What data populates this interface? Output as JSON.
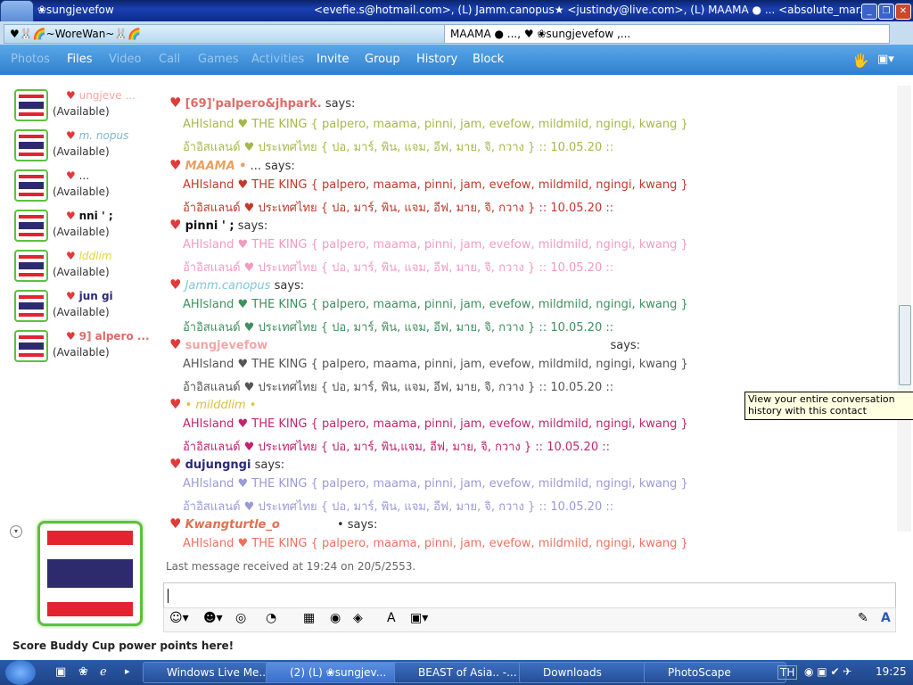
{
  "window": {
    "title": "❀sungjevefow",
    "title_participants": "<evefie.s@hotmail.com>, (L) Jamm.canopus★ <justindy@live.com>, (L) MAAMA ● ... <absolute_mar...",
    "controls": [
      "minimize",
      "restore",
      "close"
    ]
  },
  "conversation_tabs": [
    {
      "label": "♥🐰🌈~WoreWan~🐰🌈"
    },
    {
      "label": "MAAMA ● ..., ♥ ❀sungjevefow ,..."
    }
  ],
  "menu": {
    "items": [
      {
        "label": "Photos",
        "enabled": false
      },
      {
        "label": "Files",
        "enabled": true
      },
      {
        "label": "Video",
        "enabled": false
      },
      {
        "label": "Call",
        "enabled": false
      },
      {
        "label": "Games",
        "enabled": false
      },
      {
        "label": "Activities",
        "enabled": false
      },
      {
        "label": "Invite",
        "enabled": true
      },
      {
        "label": "Group",
        "enabled": true
      },
      {
        "label": "History",
        "enabled": true
      },
      {
        "label": "Block",
        "enabled": true
      }
    ]
  },
  "contacts": [
    {
      "name": "ungjeve ...",
      "name_color": "#f4a6a6",
      "status": "(Available)"
    },
    {
      "name": "m. nopus",
      "name_color": "#7fb6d9",
      "status": "(Available)"
    },
    {
      "name": "...",
      "name_color": "#333333",
      "status": "(Available)"
    },
    {
      "name": "nni ' ;",
      "name_color": "#111111",
      "status": "(Available)"
    },
    {
      "name": "lddlim",
      "name_color": "#e6d23a",
      "status": "(Available)"
    },
    {
      "name": "jun gi",
      "name_color": "#2a2a7a",
      "status": "(Available)"
    },
    {
      "name": "9] alpero ...",
      "name_color": "#e06a6a",
      "status": "(Available)"
    }
  ],
  "messages": [
    {
      "sender": "[69]'palpero&jhpark.",
      "sender_color": "#e06a6a",
      "says": "says:",
      "line1": "AHIsland ♥ THE KING { palpero, maama, pinni, jam, evefow, mildmild, ngingi, kwang }",
      "line2": "อ้าอิสแลนด์ ♥ ประเทศไทย { ปอ, มาร์, พิน, แจม, อีฟ, มาย, จิ, กวาง } :: 10.05.20 ::",
      "color": "#a6b84a"
    },
    {
      "sender": "MAAMA •",
      "sender_color": "#e8a060",
      "says": "... says:",
      "line1": "AHIsland ♥ THE KING { palpero, maama, pinni, jam, evefow, mildmild, ngingi, kwang }",
      "line2": "อ้าอิสแลนด์ ♥ ประเทศไทย { ปอ, มาร์, พิน, แจม, อีฟ, มาย, จิ, กวาง } :: 10.05.20 ::",
      "color": "#c0392b"
    },
    {
      "sender": "pinni ' ;",
      "sender_color": "#111111",
      "says": "says:",
      "line1": "AHIsland ♥ THE KING { palpero, maama, pinni, jam, evefow, mildmild, ngingi, kwang }",
      "line2": "อ้าอิสแลนด์ ♥ ประเทศไทย { ปอ, มาร์, พิน, แจม, อีฟ, มาย, จิ, กวาง } :: 10.05.20 ::",
      "color": "#f29ac0"
    },
    {
      "sender": "Jamm.canopus",
      "sender_color": "#7fc6d9",
      "says": "says:",
      "line1": "AHIsland ♥ THE KING { palpero, maama, pinni, jam, evefow, mildmild, ngingi, kwang }",
      "line2": "อ้าอิสแลนด์ ♥ ประเทศไทย { ปอ, มาร์, พิน, แจม, อีฟ, มาย, จิ, กวาง } :: 10.05.20 ::",
      "color": "#3f8f5f"
    },
    {
      "sender": "sungjevefow",
      "sender_color": "#f4a6a6",
      "says": "says:",
      "line1": "AHIsland ♥ THE KING { palpero, maama, pinni, jam, evefow, mildmild, ngingi, kwang }",
      "line2": "อ้าอิสแลนด์ ♥ ประเทศไทย { ปอ, มาร์, พิน, แจม, อีฟ, มาย, จิ, กวาง } :: 10.05.20 ::",
      "color": "#555555"
    },
    {
      "sender": "• milddlim •",
      "sender_color": "#d9c23a",
      "says": "",
      "line1": "AHIsland ♥ THE KING { palpero, maama, pinni, jam, evefow, mildmild, ngingi, kwang }",
      "line2": "อ้าอิสแลนด์ ♥ ประเทศไทย { ปอ, มาร์, พิน,แจม, อีฟ, มาย, จิ, กวาง } :: 10.05.20 ::",
      "color": "#c0246e"
    },
    {
      "sender": "dujungngi",
      "sender_color": "#2a2a7a",
      "says": "says:",
      "line1": "AHIsland ♥ THE KING { palpero, maama, pinni, jam, evefow, mildmild, ngingi, kwang }",
      "line2": "อ้าอิสแลนด์ ♥ ประเทศไทย { ปอ, มาร์, พิน, แจม, อีฟ, มาย, จิ, กวาง } :: 10.05.20 ::",
      "color": "#9a9ad6"
    },
    {
      "sender": "Kwangturtle_o",
      "sender_color": "#e07050",
      "says": "• says:",
      "line1": "AHIsland ♥ THE KING { palpero, maama, pinni, jam, evefow, mildmild, ngingi, kwang }",
      "line2": "",
      "color": "#f07060"
    }
  ],
  "tooltip": "View your entire conversation history with this contact",
  "last_message": "Last message received at 19:24 on 20/5/2553.",
  "input": {
    "value": ""
  },
  "promo": "Score Buddy Cup power points here!",
  "taskbar": {
    "tasks": [
      {
        "label": "Windows Live Me...",
        "active": false
      },
      {
        "label": "(2) (L) ❀sungjev...",
        "active": true
      },
      {
        "label": "BEAST of Asia.. -...",
        "active": false
      },
      {
        "label": "Downloads",
        "active": false
      },
      {
        "label": "PhotoScape",
        "active": false
      }
    ],
    "language": "TH",
    "clock": "19:25"
  }
}
